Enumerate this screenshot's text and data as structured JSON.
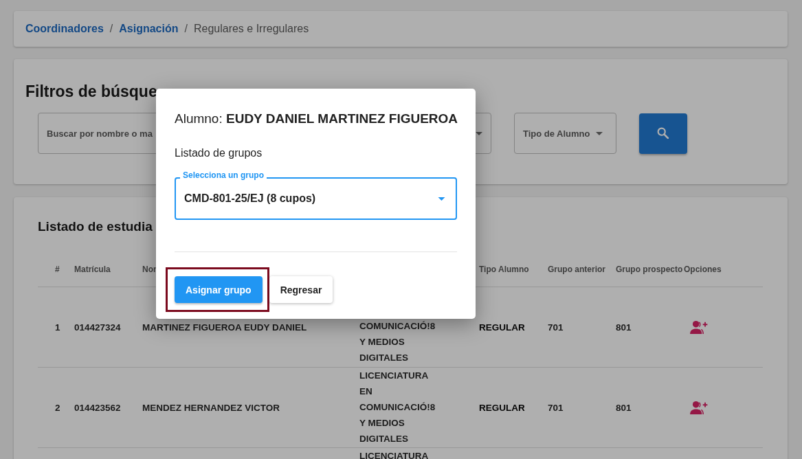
{
  "breadcrumb": [
    {
      "label": "Coordinadores",
      "kind": "link"
    },
    {
      "separator": "/",
      "label": "Asignación",
      "kind": "link"
    },
    {
      "separator": "/",
      "label": "Regulares e Irregulares",
      "kind": "current"
    }
  ],
  "filters": {
    "title": "Filtros de búsque",
    "search": {
      "placeholder": "Buscar por nombre o ma"
    },
    "student_type": {
      "label": "Tipo de Alumno"
    }
  },
  "students": {
    "title": "Listado de estudia",
    "columns": [
      "#",
      "Matrícula",
      "Nor",
      "",
      "Tipo Alumno",
      "Grupo anterior",
      "Grupo prospecto",
      "Opciones"
    ],
    "rows": [
      {
        "number": "1",
        "id": "014427324",
        "name": "MARTINEZ FIGUEROA EUDY DANIEL",
        "program": [
          "COMUNICACIÓ!8",
          "Y MEDIOS",
          "DIGITALES"
        ],
        "type": "REGULAR",
        "previous_group": "701",
        "prospect_group": "801"
      },
      {
        "number": "2",
        "id": "014423562",
        "name": "MENDEZ HERNANDEZ VICTOR",
        "program": [
          "LICENCIATURA",
          "EN",
          "COMUNICACIÓ!8",
          "Y MEDIOS",
          "DIGITALES"
        ],
        "type": "REGULAR",
        "previous_group": "701",
        "prospect_group": "801"
      },
      {
        "program": [
          "LICENCIATURA"
        ]
      }
    ]
  },
  "dialog": {
    "title_label": "Alumno:",
    "student_name": "EUDY DANIEL MARTINEZ FIGUEROA",
    "section": "Listado de grupos",
    "group_select": {
      "label": "Selecciona un grupo",
      "value": "CMD-801-25/EJ (8 cupos)"
    },
    "buttons": [
      {
        "label": "Asignar grupo",
        "kind": "primary",
        "highlighted": true
      },
      {
        "label": "Regresar",
        "kind": "secondary",
        "highlighted": false
      }
    ]
  }
}
